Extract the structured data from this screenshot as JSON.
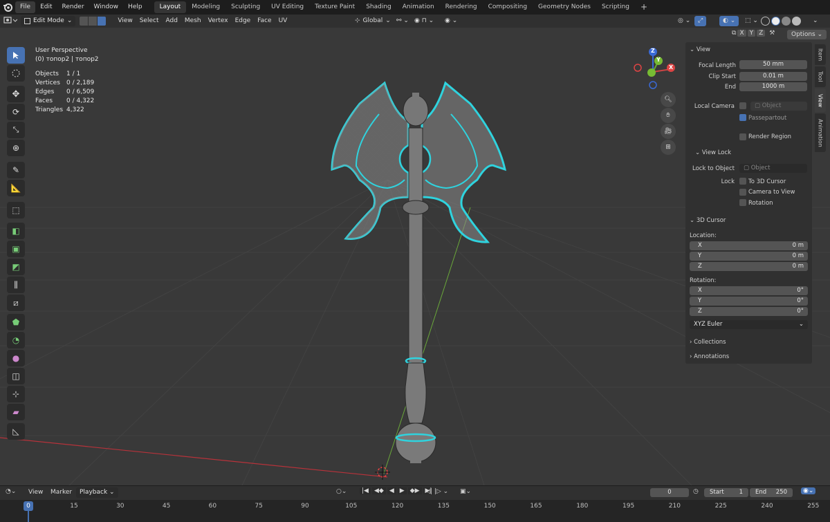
{
  "menu": [
    "File",
    "Edit",
    "Render",
    "Window",
    "Help"
  ],
  "workspaces": [
    "Layout",
    "Modeling",
    "Sculpting",
    "UV Editing",
    "Texture Paint",
    "Shading",
    "Animation",
    "Rendering",
    "Compositing",
    "Geometry Nodes",
    "Scripting"
  ],
  "workspaces_add": "+",
  "header": {
    "mode": "Edit Mode",
    "menus": [
      "View",
      "Select",
      "Add",
      "Mesh",
      "Vertex",
      "Edge",
      "Face",
      "UV"
    ],
    "transform_orientation": "Global",
    "axes": [
      "X",
      "Y",
      "Z"
    ],
    "options": "Options"
  },
  "viewport": {
    "view_name": "User Perspective",
    "object_name": "(0) топор2 | топор2",
    "stats": [
      {
        "label": "Objects",
        "value": "1 / 1"
      },
      {
        "label": "Vertices",
        "value": "0 / 2,189"
      },
      {
        "label": "Edges",
        "value": "0 / 6,509"
      },
      {
        "label": "Faces",
        "value": "0 / 4,322"
      },
      {
        "label": "Triangles",
        "value": "4,322"
      }
    ],
    "gizmo": {
      "x": "X",
      "y": "Y",
      "z": "Z"
    }
  },
  "npanel": {
    "view_title": "View",
    "focal_length_label": "Focal Length",
    "focal_length": "50 mm",
    "clip_start_label": "Clip Start",
    "clip_start": "0.01 m",
    "end_label": "End",
    "clip_end": "1000 m",
    "local_camera_label": "Local Camera",
    "object_placeholder": "Object",
    "passepartout": "Passepartout",
    "render_region": "Render Region",
    "view_lock_title": "View Lock",
    "lock_to_object_label": "Lock to Object",
    "lock_label": "Lock",
    "to_3d_cursor": "To 3D Cursor",
    "camera_to_view": "Camera to View",
    "rotation_lock": "Rotation",
    "cursor_title": "3D Cursor",
    "location_label": "Location:",
    "loc_x_label": "X",
    "loc_x": "0 m",
    "loc_y_label": "Y",
    "loc_y": "0 m",
    "loc_z_label": "Z",
    "loc_z": "0 m",
    "rotation_label": "Rotation:",
    "rot_x_label": "X",
    "rot_x": "0°",
    "rot_y_label": "Y",
    "rot_y": "0°",
    "rot_z_label": "Z",
    "rot_z": "0°",
    "rotation_mode": "XYZ Euler",
    "collections": "Collections",
    "annotations": "Annotations",
    "tabs": [
      "Item",
      "Tool",
      "View",
      "Animation"
    ]
  },
  "timeline": {
    "menus": [
      "View",
      "Marker",
      "Playback"
    ],
    "current_frame": "0",
    "start_label": "Start",
    "start": "1",
    "end_label": "End",
    "end": "250",
    "playhead": "0",
    "ticks": [
      "15",
      "30",
      "45",
      "60",
      "75",
      "90",
      "105",
      "120",
      "135",
      "150",
      "165",
      "180",
      "195",
      "210",
      "225",
      "240",
      "255"
    ]
  },
  "colors": {
    "active": "#4772b3",
    "wire_select": "#2fd3de",
    "x_axis": "#c03a3a",
    "y_axis": "#6aa83a"
  }
}
